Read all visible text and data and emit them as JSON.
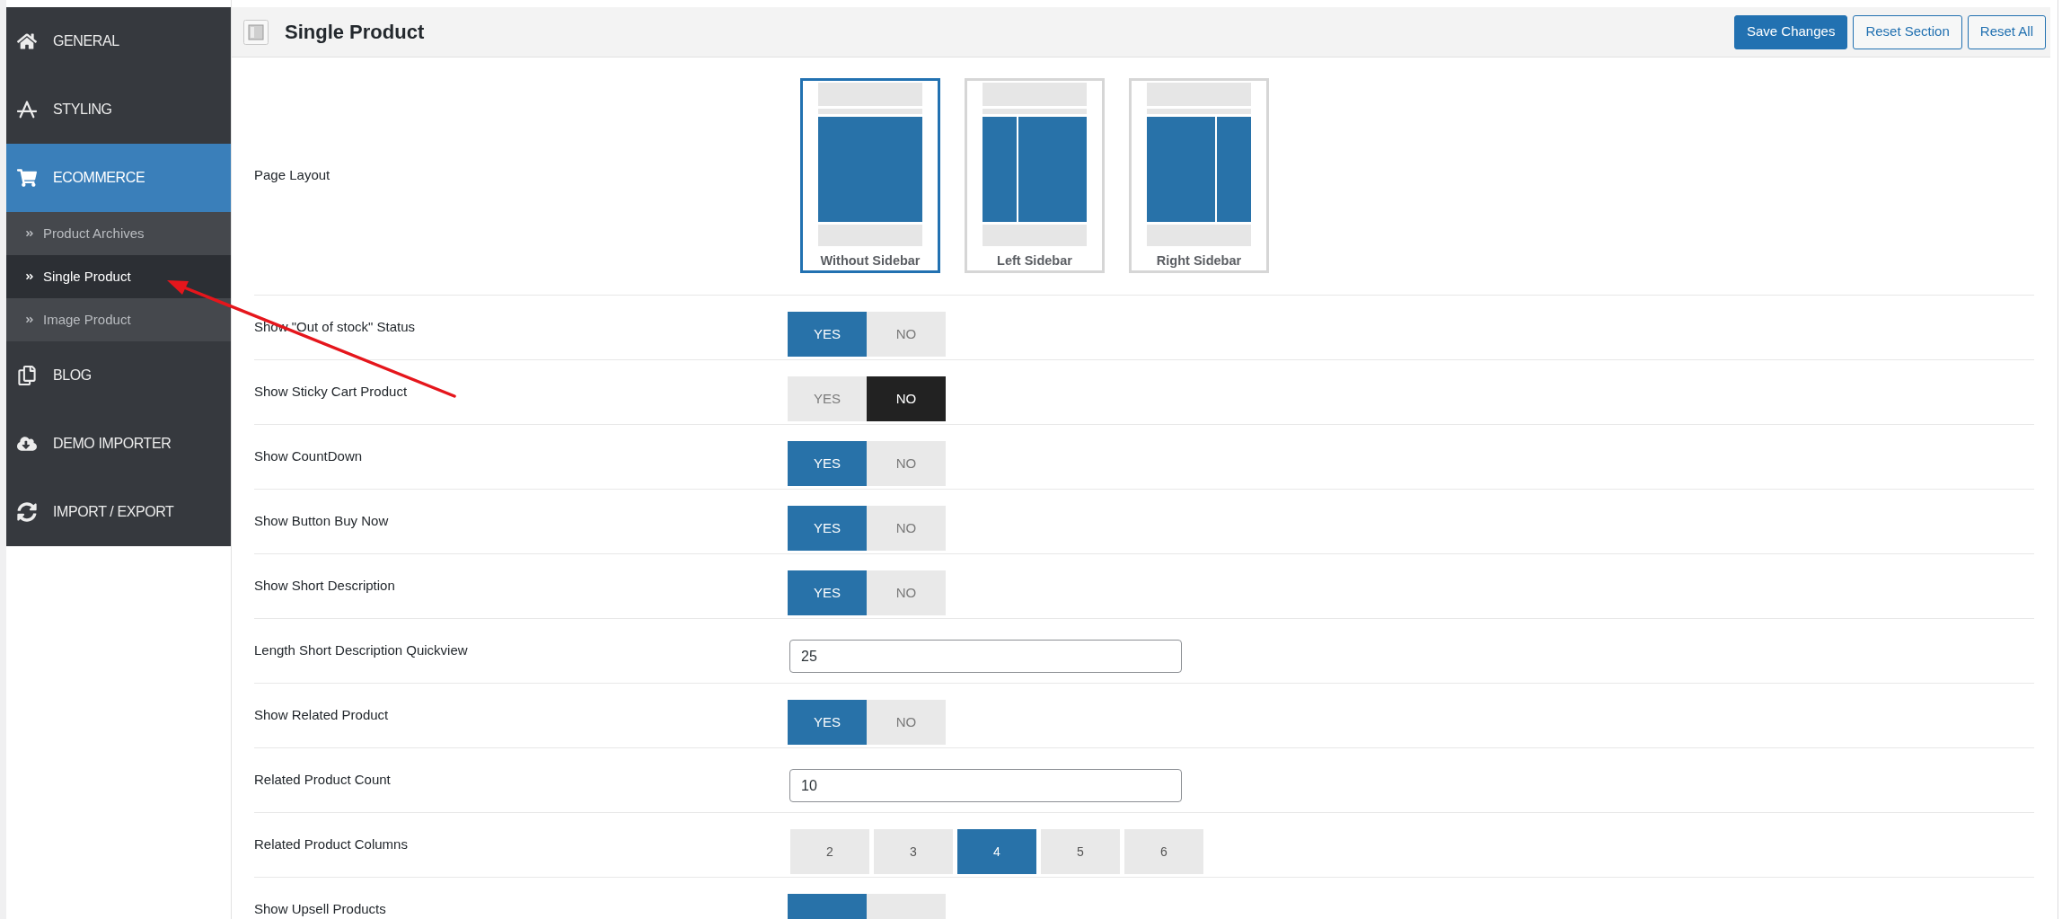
{
  "sidebar": {
    "items": [
      {
        "label": "GENERAL",
        "kind": "home",
        "selected": false
      },
      {
        "label": "STYLING",
        "kind": "styling",
        "selected": false
      },
      {
        "label": "ECOMMERCE",
        "kind": "cart",
        "selected": true,
        "children": [
          {
            "label": "Product Archives",
            "selected": false
          },
          {
            "label": "Single Product",
            "selected": true
          },
          {
            "label": "Image Product",
            "selected": false
          }
        ]
      },
      {
        "label": "BLOG",
        "kind": "blog",
        "selected": false
      },
      {
        "label": "DEMO IMPORTER",
        "kind": "download",
        "selected": false
      },
      {
        "label": "IMPORT / EXPORT",
        "kind": "sync",
        "selected": false
      }
    ]
  },
  "header": {
    "title": "Single Product",
    "buttons": [
      {
        "label": "Save Changes",
        "kind": "primary"
      },
      {
        "label": "Reset Section",
        "kind": "secondary"
      },
      {
        "label": "Reset All",
        "kind": "secondary"
      }
    ]
  },
  "settings": [
    {
      "kind": "layout",
      "label": "Page Layout",
      "options": [
        {
          "label": "Without Sidebar",
          "kind": "none",
          "selected": true
        },
        {
          "label": "Left Sidebar",
          "kind": "left",
          "selected": false
        },
        {
          "label": "Right Sidebar",
          "kind": "right",
          "selected": false
        }
      ]
    },
    {
      "kind": "switch",
      "label": "Show \"Out of stock\" Status",
      "options": [
        {
          "label": "YES",
          "selected": true
        },
        {
          "label": "NO",
          "selected": false
        }
      ]
    },
    {
      "kind": "switch",
      "label": "Show Sticky Cart Product",
      "options": [
        {
          "label": "YES",
          "selected": false
        },
        {
          "label": "NO",
          "selected": true
        }
      ]
    },
    {
      "kind": "switch",
      "label": "Show CountDown",
      "options": [
        {
          "label": "YES",
          "selected": true
        },
        {
          "label": "NO",
          "selected": false
        }
      ]
    },
    {
      "kind": "switch",
      "label": "Show Button Buy Now",
      "options": [
        {
          "label": "YES",
          "selected": true
        },
        {
          "label": "NO",
          "selected": false
        }
      ]
    },
    {
      "kind": "switch",
      "label": "Show Short Description",
      "options": [
        {
          "label": "YES",
          "selected": true
        },
        {
          "label": "NO",
          "selected": false
        }
      ]
    },
    {
      "kind": "number",
      "label": "Length Short Description Quickview",
      "value": "25"
    },
    {
      "kind": "switch",
      "label": "Show Related Product",
      "options": [
        {
          "label": "YES",
          "selected": true
        },
        {
          "label": "NO",
          "selected": false
        }
      ]
    },
    {
      "kind": "number",
      "label": "Related Product Count",
      "value": "10"
    },
    {
      "kind": "buttonset",
      "label": "Related Product Columns",
      "options": [
        {
          "label": "2",
          "selected": false
        },
        {
          "label": "3",
          "selected": false
        },
        {
          "label": "4",
          "selected": true
        },
        {
          "label": "5",
          "selected": false
        },
        {
          "label": "6",
          "selected": false
        }
      ]
    },
    {
      "kind": "switch",
      "label": "Show Upsell Products",
      "options": [
        {
          "selected": true
        },
        {
          "selected": false
        }
      ]
    }
  ]
}
